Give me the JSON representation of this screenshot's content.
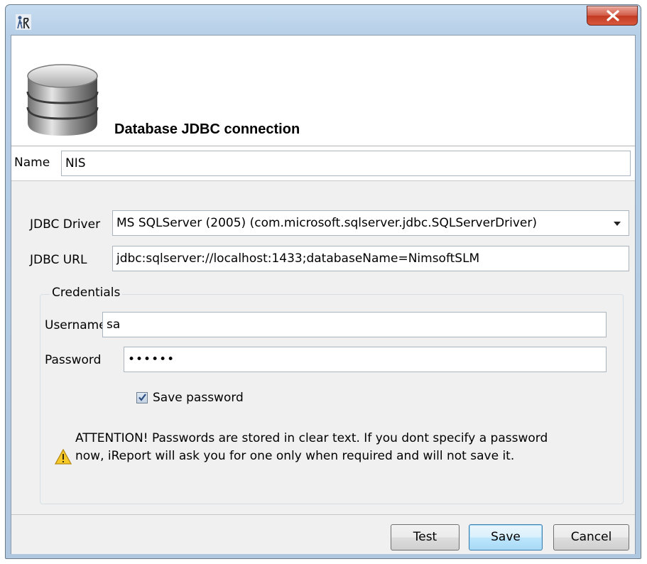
{
  "window": {
    "icon": "ireport-app-icon",
    "close_icon": "close-x-icon"
  },
  "header": {
    "icon": "database-icon",
    "title": "Database JDBC connection"
  },
  "name": {
    "label": "Name",
    "value": "NIS"
  },
  "jdbc": {
    "driver_label": "JDBC Driver",
    "driver_value": "MS SQLServer (2005) (com.microsoft.sqlserver.jdbc.SQLServerDriver)",
    "url_label": "JDBC URL",
    "url_value": "jdbc:sqlserver://localhost:1433;databaseName=NimsoftSLM"
  },
  "credentials": {
    "legend": "Credentials",
    "username_label": "Username",
    "username_value": "sa",
    "password_label": "Password",
    "password_value": "••••••",
    "save_password_label": "Save password",
    "save_password_checked": true,
    "warning_icon": "warning-triangle-icon",
    "warning_text": "ATTENTION! Passwords are stored in clear text. If you dont specify a password now, iReport will ask you for one only when required and will not save it."
  },
  "buttons": {
    "test": "Test",
    "save": "Save",
    "cancel": "Cancel"
  },
  "colors": {
    "titlebar": "#b7d0e8",
    "close_button": "#c8452e",
    "dialog_bg": "#f0f0f0",
    "default_button": "#bee6fd",
    "warning": "#f0c020"
  }
}
